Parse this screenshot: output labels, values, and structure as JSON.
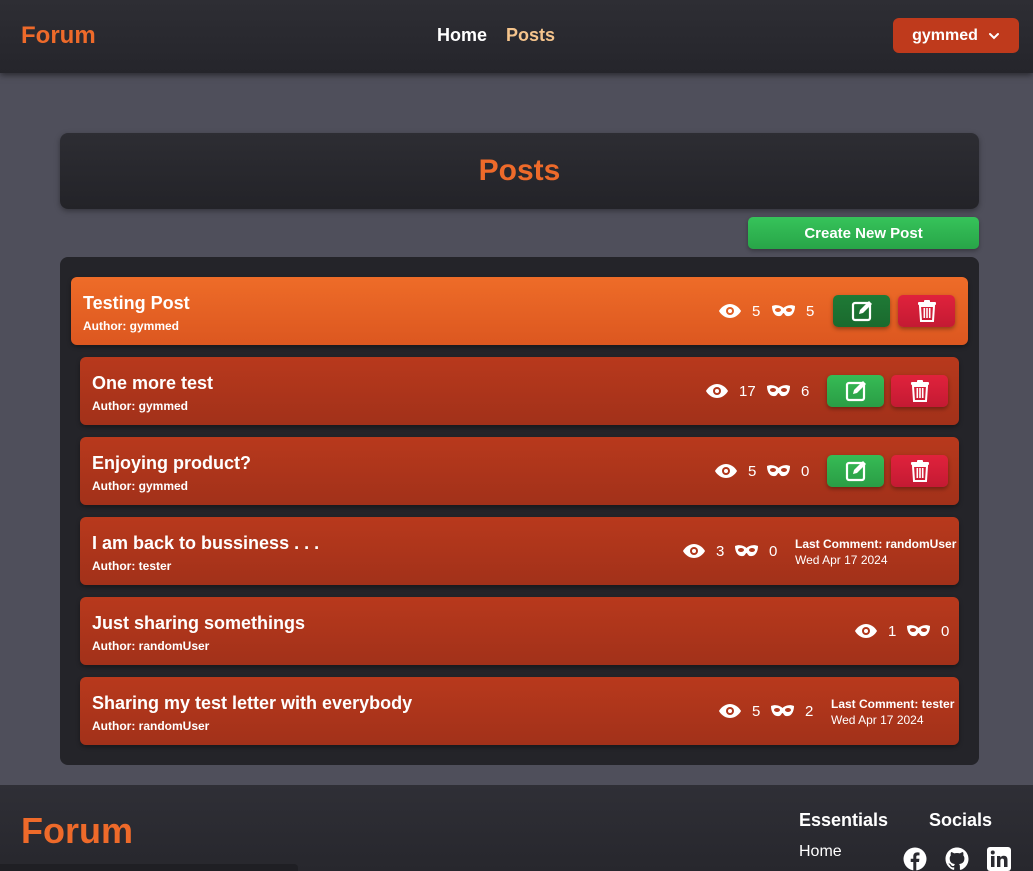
{
  "navbar": {
    "brand": "Forum",
    "links": [
      "Home",
      "Posts"
    ],
    "active_link": "Posts",
    "user": "gymmed"
  },
  "page": {
    "title": "Posts",
    "create_button": "Create New Post"
  },
  "posts": [
    {
      "title": "Testing Post",
      "author": "Author: gymmed",
      "views": "5",
      "masks": "5",
      "can_edit": true,
      "highlight": true
    },
    {
      "title": "One more test",
      "author": "Author: gymmed",
      "views": "17",
      "masks": "6",
      "can_edit": true
    },
    {
      "title": "Enjoying product?",
      "author": "Author: gymmed",
      "views": "5",
      "masks": "0",
      "can_edit": true
    },
    {
      "title": "I am back to bussiness . . .",
      "author": "Author: tester",
      "views": "3",
      "masks": "0",
      "last_comment": "Last Comment: randomUser",
      "last_comment_date": "Wed Apr 17 2024"
    },
    {
      "title": "Just sharing somethings",
      "author": "Author: randomUser",
      "views": "1",
      "masks": "0"
    },
    {
      "title": "Sharing my test letter with everybody",
      "author": "Author: randomUser",
      "views": "5",
      "masks": "2",
      "last_comment": "Last Comment: tester",
      "last_comment_date": "Wed Apr 17 2024"
    }
  ],
  "footer": {
    "brand": "Forum",
    "essentials_heading": "Essentials",
    "essentials_links": [
      "Home"
    ],
    "socials_heading": "Socials",
    "socials": [
      "facebook-icon",
      "github-icon",
      "linkedin-icon"
    ]
  },
  "colors": {
    "accent": "#ee6a2a",
    "card": "#b8391c",
    "card_highlight": "#ee6c28",
    "edit": "#36bb55",
    "delete": "#e0223c"
  }
}
